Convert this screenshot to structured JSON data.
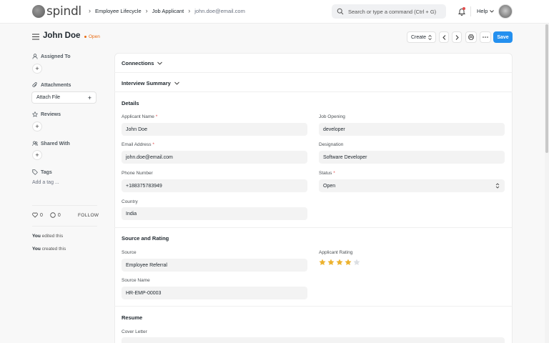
{
  "navbar": {
    "logo_text": "spindl",
    "breadcrumbs": [
      "Employee Lifecycle",
      "Job Applicant",
      "john.doe@email.com"
    ],
    "search_placeholder": "Search or type a command (Ctrl + G)",
    "help_label": "Help"
  },
  "page": {
    "title": "John Doe",
    "status": "Open",
    "status_color": "#e86c13",
    "create_label": "Create",
    "save_label": "Save",
    "accent_color": "#2490ef"
  },
  "sidebar": {
    "assigned_to": "Assigned To",
    "attachments": "Attachments",
    "attach_file": "Attach File",
    "reviews": "Reviews",
    "shared_with": "Shared With",
    "tags": "Tags",
    "add_tag": "Add a tag ...",
    "likes_count": "0",
    "comments_count": "0",
    "follow": "FOLLOW",
    "activity": [
      {
        "actor": "You",
        "text": " edited this"
      },
      {
        "actor": "You",
        "text": " created this"
      }
    ]
  },
  "form": {
    "connections": "Connections",
    "interview_summary": "Interview Summary",
    "details_heading": "Details",
    "applicant_name_label": "Applicant Name",
    "applicant_name": "John Doe",
    "job_opening_label": "Job Opening",
    "job_opening": "developer",
    "email_label": "Email Address",
    "email": "john.doe@email.com",
    "designation_label": "Designation",
    "designation": "Software Developer",
    "phone_label": "Phone Number",
    "phone": "+188375783949",
    "status_label": "Status",
    "status": "Open",
    "country_label": "Country",
    "country": "India",
    "source_heading": "Source and Rating",
    "source_label": "Source",
    "source": "Employee Referral",
    "applicant_rating_label": "Applicant Rating",
    "applicant_rating": 4,
    "rating_max": 5,
    "source_name_label": "Source Name",
    "source_name": "HR-EMP-00003",
    "resume_heading": "Resume",
    "cover_letter_label": "Cover Letter",
    "required_marker": "*"
  }
}
